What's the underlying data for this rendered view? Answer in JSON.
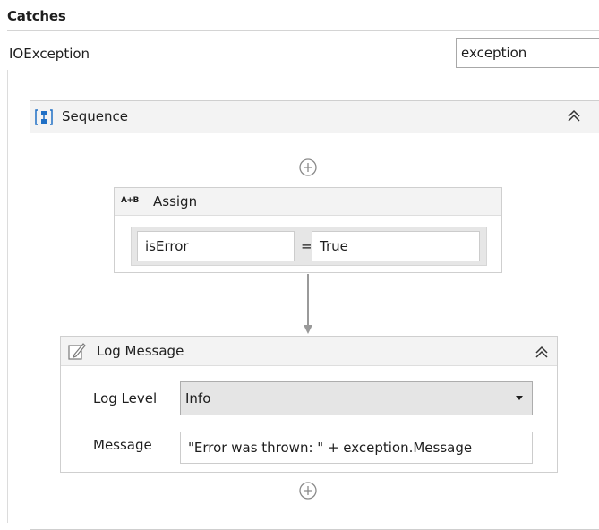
{
  "catches": {
    "title": "Catches",
    "exception_type": "IOException",
    "exception_variable": "exception"
  },
  "sequence": {
    "title": "Sequence",
    "icon": "sequence-icon",
    "collapse_icon": "double-chevron-up-icon"
  },
  "assign": {
    "icon_text": "A+B",
    "title": "Assign",
    "to": "isError",
    "operator": "=",
    "value": "True"
  },
  "log_message": {
    "title": "Log Message",
    "icon": "pencil-note-icon",
    "log_level_label": "Log Level",
    "log_level_value": "Info",
    "message_label": "Message",
    "message_value": "\"Error was thrown: \" + exception.Message"
  },
  "colors": {
    "accent_blue": "#1f6fc5",
    "header_bg": "#f3f3f3",
    "border": "#cfcfcf"
  }
}
